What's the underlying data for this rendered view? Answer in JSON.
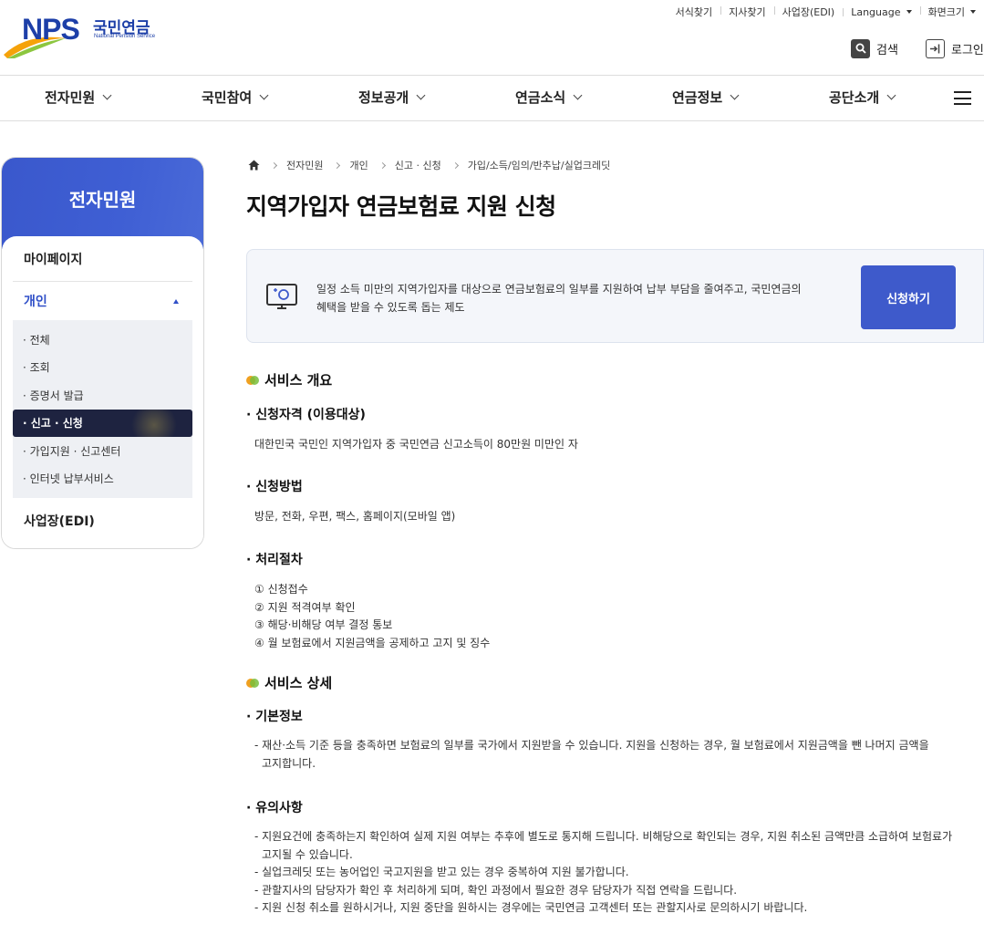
{
  "header": {
    "logo_text": "NPS",
    "logo_kr": "국민연금",
    "logo_en": "National Pension Service",
    "util_links": [
      "서식찾기",
      "지사찾기",
      "사업장(EDI)",
      "Language",
      "화면크기"
    ],
    "search_label": "검색",
    "login_label": "로그인"
  },
  "gnb": [
    "전자민원",
    "국민참여",
    "정보공개",
    "연금소식",
    "연금정보",
    "공단소개"
  ],
  "sidebar": {
    "title": "전자민원",
    "items": [
      {
        "label": "마이페이지"
      },
      {
        "label": "개인"
      },
      {
        "label": "사업장(EDI)"
      }
    ],
    "sub_items": [
      "· 전체",
      "· 조회",
      "· 증명서 발급",
      "· 신고 · 신청",
      "· 가입지원 · 신고센터",
      "· 인터넷 납부서비스"
    ]
  },
  "breadcrumb": [
    "전자민원",
    "개인",
    "신고 · 신청",
    "가입/소득/임의/반추납/실업크레딧"
  ],
  "page_title": "지역가입자 연금보험료 지원 신청",
  "intro": {
    "line1": "일정 소득 미만의 지역가입자를 대상으로 연금보험료의 일부를 지원하여 납부 부담을 줄여주고, 국민연금의",
    "line2": "혜택을 받을 수 있도록 돕는 제도",
    "apply_label": "신청하기"
  },
  "overview": {
    "heading": "서비스 개요",
    "eligibility_title": "· 신청자격 (이용대상)",
    "eligibility_text": "대한민국 국민인 지역가입자 중 국민연금 신고소득이 80만원 미만인 자",
    "method_title": "· 신청방법",
    "method_text": "방문, 전화, 우편, 팩스, 홈페이지(모바일 앱)",
    "process_title": "· 처리절차",
    "process_steps": [
      "① 신청접수",
      "② 지원 적격여부 확인",
      "③ 해당·비해당 여부 결정 통보",
      "④ 월 보험료에서 지원금액을 공제하고 고지 및 징수"
    ]
  },
  "detail": {
    "heading": "서비스 상세",
    "basic_title": "· 기본정보",
    "basic_lines": [
      "- 재산·소득 기준 등을 충족하면 보험료의 일부를 국가에서 지원받을 수 있습니다. 지원을 신청하는 경우, 월 보험료에서 지원금액을 뺀 나머지 금액을",
      "고지합니다."
    ],
    "notes_title": "· 유의사항",
    "notes_lines": [
      "- 지원요건에 충족하는지 확인하여 실제 지원 여부는 추후에 별도로 통지해 드립니다. 비해당으로 확인되는 경우, 지원 취소된 금액만큼 소급하여 보험료가",
      "고지될 수 있습니다.",
      "- 실업크레딧 또는 농어업인 국고지원을 받고 있는 경우 중복하여 지원 불가합니다.",
      "- 관할지사의 담당자가 확인 후 처리하게 되며, 확인 과정에서 필요한 경우 담당자가 직접 연락을 드립니다.",
      "- 지원 신청 취소를 원하시거나, 지원 중단을 원하시는 경우에는 국민연금 고객센터 또는 관할지사로 문의하시기 바랍니다."
    ]
  }
}
